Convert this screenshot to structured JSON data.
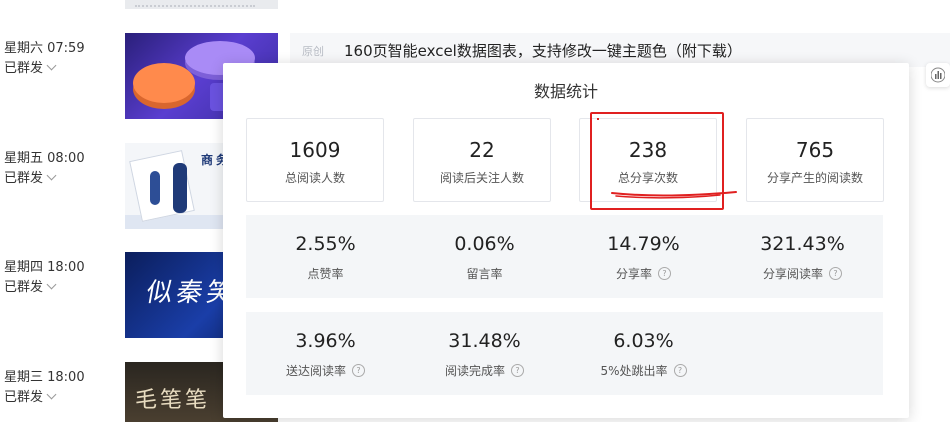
{
  "articles": [
    {
      "time": "星期六 07:59",
      "status": "已群发",
      "tag": "原创",
      "title": "160页智能excel数据图表，支持修改一键主题色（附下载）"
    },
    {
      "time": "星期五 08:00",
      "status": "已群发",
      "thumb_text": "商务"
    },
    {
      "time": "星期四 18:00",
      "status": "已群发",
      "thumb_text": "似秦笑"
    },
    {
      "time": "星期三 18:00",
      "status": "已群发",
      "thumb_text": "毛笔笔"
    }
  ],
  "stats": {
    "title": "数据统计",
    "cards": [
      {
        "value": "1609",
        "label": "总阅读人数"
      },
      {
        "value": "22",
        "label": "阅读后关注人数"
      },
      {
        "value": "238",
        "label": "总分享次数"
      },
      {
        "value": "765",
        "label": "分享产生的阅读数"
      }
    ],
    "rates_row1": [
      {
        "value": "2.55%",
        "label": "点赞率",
        "has_help": false
      },
      {
        "value": "0.06%",
        "label": "留言率",
        "has_help": false
      },
      {
        "value": "14.79%",
        "label": "分享率",
        "has_help": true
      },
      {
        "value": "321.43%",
        "label": "分享阅读率",
        "has_help": true
      }
    ],
    "rates_row2": [
      {
        "value": "3.96%",
        "label": "送达阅读率",
        "has_help": true
      },
      {
        "value": "31.48%",
        "label": "阅读完成率",
        "has_help": true
      },
      {
        "value": "6.03%",
        "label": "5%处跳出率",
        "has_help": true
      }
    ],
    "help_glyph": "?"
  },
  "icons": {
    "chevron": "chevron-down-icon",
    "help": "question-circle-icon",
    "stats": "bar-chart-icon"
  },
  "colors": {
    "highlight": "#e02020",
    "panel_bg": "#f4f6f8",
    "card_border": "#e4e6eb"
  }
}
